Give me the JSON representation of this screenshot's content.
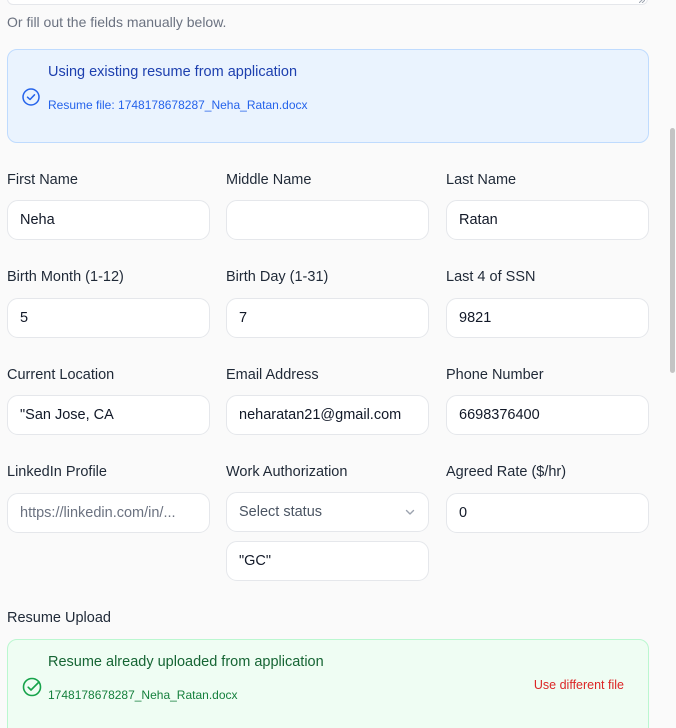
{
  "form": {
    "hint": "Or fill out the fields manually below.",
    "resume_info": {
      "title": "Using existing resume from application",
      "file_line": "Resume file: 1748178678287_Neha_Ratan.docx"
    },
    "fields": {
      "first_name": {
        "label": "First Name",
        "value": "Neha"
      },
      "middle_name": {
        "label": "Middle Name",
        "value": ""
      },
      "last_name": {
        "label": "Last Name",
        "value": "Ratan"
      },
      "birth_month": {
        "label": "Birth Month (1-12)",
        "value": "5"
      },
      "birth_day": {
        "label": "Birth Day (1-31)",
        "value": "7"
      },
      "ssn_last4": {
        "label": "Last 4 of SSN",
        "value": "9821"
      },
      "location": {
        "label": "Current Location",
        "value": "\"San Jose, CA"
      },
      "email": {
        "label": "Email Address",
        "value": "neharatan21@gmail.com"
      },
      "phone": {
        "label": "Phone Number",
        "value": "6698376400"
      },
      "linkedin": {
        "label": "LinkedIn Profile",
        "placeholder": "https://linkedin.com/in/..."
      },
      "work_auth": {
        "label": "Work Authorization",
        "selected": "Select status",
        "other_value": "\"GC\""
      },
      "rate": {
        "label": "Agreed Rate ($/hr)",
        "value": "0"
      }
    },
    "resume_upload": {
      "label": "Resume Upload",
      "title": "Resume already uploaded from application",
      "file_name": "1748178678287_Neha_Ratan.docx",
      "change_link": "Use different file"
    }
  },
  "colors": {
    "info_bg": "#eaf3fe",
    "info_text": "#1e40af",
    "success_bg": "#effdf3",
    "success_text": "#166534",
    "danger_text": "#dc2626"
  },
  "icons": {
    "info": "check-circle-icon",
    "success": "check-circle-icon",
    "select": "chevron-down-icon"
  }
}
